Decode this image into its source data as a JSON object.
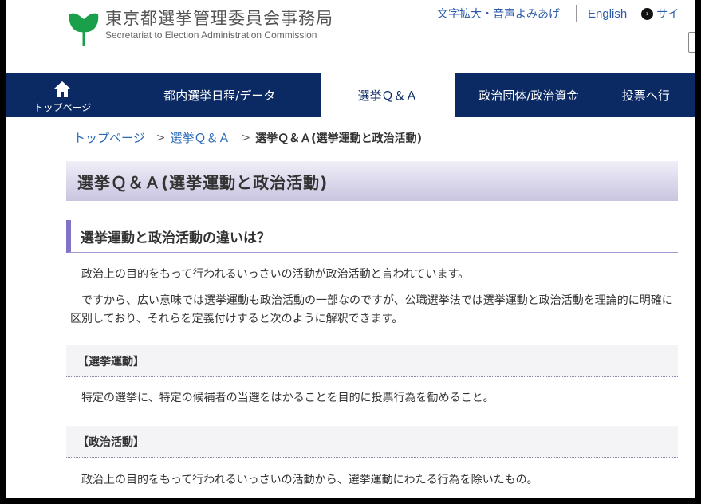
{
  "header": {
    "logo_jp": "東京都選挙管理委員会事務局",
    "logo_en": "Secretariat to Election Administration Commission",
    "util_links": {
      "text_size_voice": "文字拡大・音声よみあげ",
      "english": "English",
      "site": "サイ"
    }
  },
  "nav": {
    "home": "トップページ",
    "item1": "都内選挙日程/データ",
    "item2": "選挙Ｑ＆Ａ",
    "item3": "政治団体/政治資金",
    "item4": "投票へ行"
  },
  "breadcrumb": {
    "top": "トップページ",
    "qa": "選挙Ｑ＆Ａ",
    "current": "選挙Ｑ＆Ａ(選挙運動と政治活動)"
  },
  "page_title": "選挙Ｑ＆Ａ(選挙運動と政治活動)",
  "section": {
    "heading": "選挙運動と政治活動の違いは？",
    "para1": "政治上の目的をもって行われるいっさいの活動が政治活動と言われています。",
    "para2": "ですから、広い意味では選挙運動も政治活動の一部なのですが、公職選挙法では選挙運動と政治活動を理論的に明確に区別しており、それらを定義付けすると次のように解釈できます。",
    "sub1": "【選挙運動】",
    "sub1_text": "特定の選挙に、特定の候補者の当選をはかることを目的に投票行為を勧めること。",
    "sub2": "【政治活動】",
    "sub2_text": "政治上の目的をもって行われるいっさいの活動から、選挙運動にわたる行為を除いたもの。"
  },
  "colors": {
    "nav_bg": "#0b2a64",
    "link": "#2a6ab8",
    "accent": "#7f74c8",
    "logo_green": "#1aa04a"
  }
}
